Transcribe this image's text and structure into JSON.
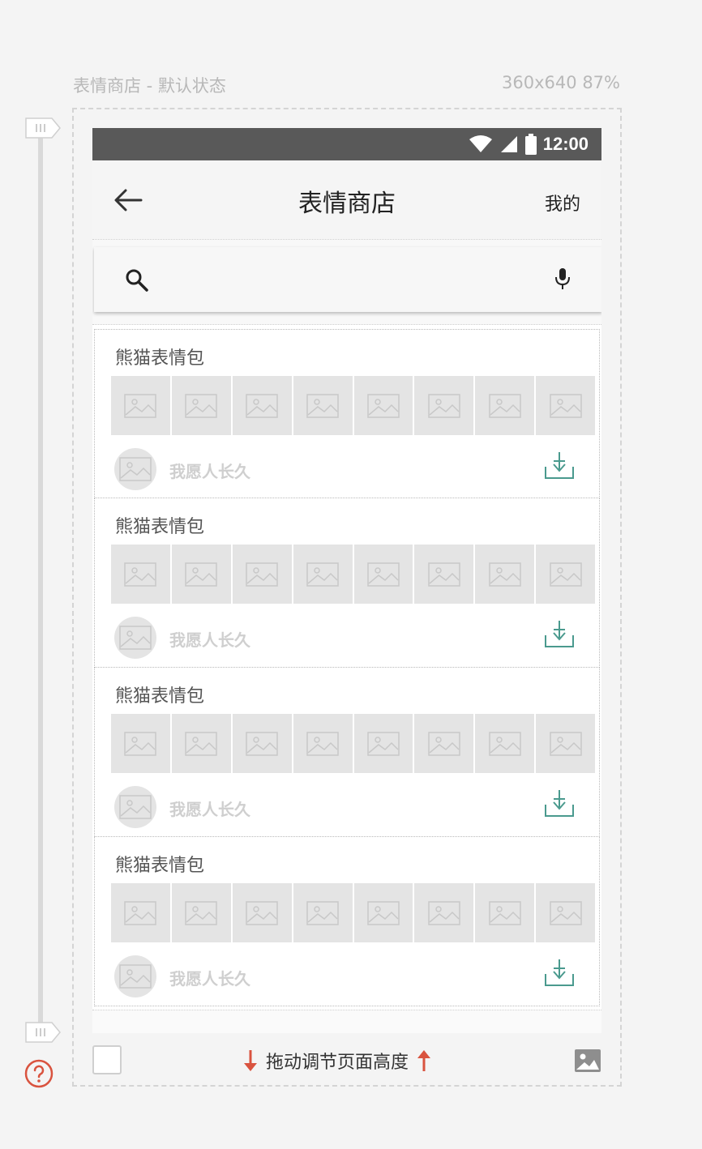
{
  "frame": {
    "title": "表情商店 - 默认状态",
    "size": "360x640 87%"
  },
  "statusbar": {
    "time": "12:00",
    "icons": [
      "wifi-icon",
      "signal-icon",
      "battery-icon"
    ]
  },
  "appbar": {
    "back_icon": "arrow-back-icon",
    "title": "表情商店",
    "action": "我的"
  },
  "search": {
    "icon": "search-icon",
    "mic_icon": "mic-icon"
  },
  "packs": [
    {
      "title": "熊猫表情包",
      "author": "我愿人长久",
      "thumb_count": 8
    },
    {
      "title": "熊猫表情包",
      "author": "我愿人长久",
      "thumb_count": 8
    },
    {
      "title": "熊猫表情包",
      "author": "我愿人长久",
      "thumb_count": 8
    },
    {
      "title": "熊猫表情包",
      "author": "我愿人长久",
      "thumb_count": 8
    }
  ],
  "footer": {
    "resize_hint": "拖动调节页面高度"
  },
  "colors": {
    "accent": "#4a9a8e",
    "statusbar": "#595959",
    "hint_arrow": "#d9533f",
    "help": "#d9533f"
  }
}
